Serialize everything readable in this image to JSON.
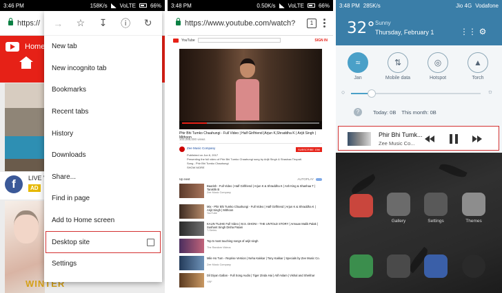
{
  "panel1": {
    "status": {
      "time": "3:46 PM",
      "speed": "158K/s",
      "network": "VoLTE",
      "battery": "66%"
    },
    "url_text": "https://",
    "header": {
      "app_name": "Home"
    },
    "feed": {
      "live_text": "LIVE V",
      "ad_badge": "AD",
      "ad_text": "WINTER"
    },
    "menu": {
      "items": [
        {
          "label": "New tab"
        },
        {
          "label": "New incognito tab"
        },
        {
          "label": "Bookmarks"
        },
        {
          "label": "Recent tabs"
        },
        {
          "label": "History"
        },
        {
          "label": "Downloads"
        },
        {
          "label": "Share..."
        },
        {
          "label": "Find in page"
        },
        {
          "label": "Add to Home screen"
        },
        {
          "label": "Desktop site"
        },
        {
          "label": "Settings"
        }
      ],
      "highlight_color": "#d32f2f"
    }
  },
  "panel2": {
    "status": {
      "time": "3:48 PM",
      "speed": "0.50K/s",
      "network": "VoLTE",
      "battery": "66%"
    },
    "url_text": "https://www.youtube.com/watch?",
    "tab_count": "1",
    "youtube": {
      "logo_text": "YouTube",
      "signin": "SIGN IN",
      "video_title": "Phir Bhi Tumko Chaahungi - Full Video | Half Girlfriend |Arjun K,Shraddha K | Arijit Singh | Mithoon",
      "views": "103,088,000 views",
      "channel_name": "Zee Music Company",
      "published": "Published on Jun 6, 2017",
      "subscribe": "SUBSCRIBE 15M",
      "description": [
        "Presenting the full video of Phir Bhi Tumko Chaahungi sung by Arijit Singh & Shashaa Tirupati.",
        "Song - Phir Bhi Tumko Chaahungi",
        "SHOW MORE"
      ],
      "up_next": "Up next",
      "autoplay": "AUTOPLAY",
      "related": [
        {
          "title": "Baarish - Full Video | Half Girlfriend | Arjun K & Shraddha K | Ash King & Shashaa T | Tanishk B",
          "channel": "Zee Music Company"
        },
        {
          "title": "Mix - Phir Bhi Tumko Chaahungi - Full Video | Half Girlfriend | Arjun K & Shraddha K | Arijit Singh | Mithoon",
          "channel": "YouTube"
        },
        {
          "title": "KAUN TUJHE Full Video | M.S. DHONI - THE UNTOLD STORY | Armaan Malik Palak | Sushant Singh Disha Patani",
          "channel": "T-Series"
        },
        {
          "title": "Top 5 most touching songs of arijit singh",
          "channel": "The Random Videos"
        },
        {
          "title": "Mile Ho Tum - Reprise Version | Neha Kakkar | Tony Kakkar | Specials by Zee Music Co.",
          "channel": "Zee Music Company"
        },
        {
          "title": "Dil Diyan Gallan - Full Song Audio | Tiger Zinda Hai | Atif Aslam | Vishal and Shekhar",
          "channel": "YRF"
        }
      ]
    }
  },
  "panel3": {
    "status": {
      "time": "3:48 PM",
      "speed": "285K/s",
      "carrier1": "Jio 4G",
      "carrier2": "Vodafone",
      "network": "4G VoLTE"
    },
    "weather": {
      "temp": "32°",
      "condition": "Sunny",
      "date": "Thursday, February 1"
    },
    "tiles": [
      {
        "label": "Jan",
        "icon": "wifi-icon"
      },
      {
        "label": "Mobile data",
        "icon": "data-icon"
      },
      {
        "label": "Hotspot",
        "icon": "hotspot-icon"
      },
      {
        "label": "Torch",
        "icon": "torch-icon"
      }
    ],
    "data_usage": {
      "today": "Today: 0B",
      "month": "This month: 0B"
    },
    "media": {
      "title": "Phir Bhi Tumk...",
      "artist": "Zee Music Co..."
    },
    "home_apps": [
      {
        "label": "Gallery"
      },
      {
        "label": "Settings"
      },
      {
        "label": "Themes"
      }
    ],
    "accent": "#3a7ea8"
  }
}
